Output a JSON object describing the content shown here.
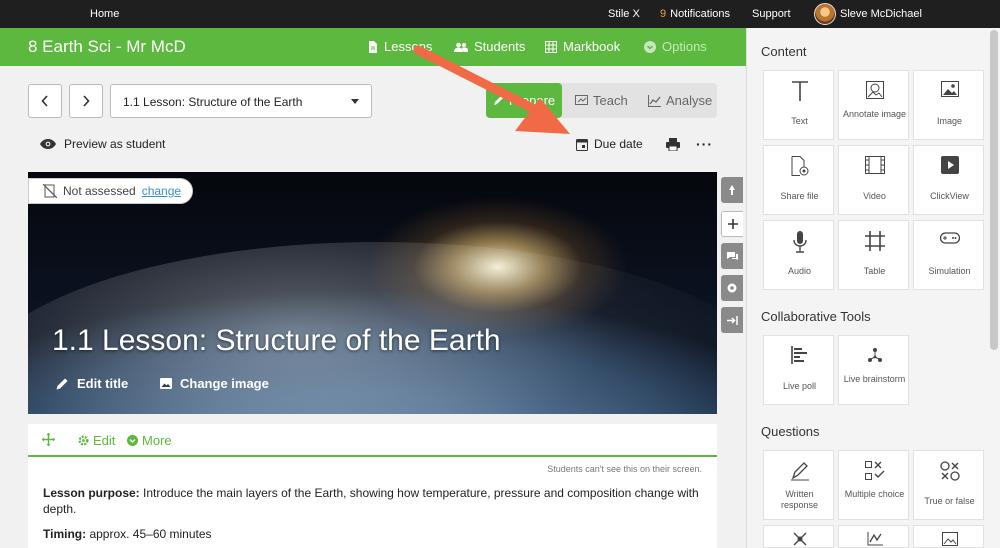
{
  "topbar": {
    "home": "Home",
    "stile": "Stile X",
    "notif_count": "9",
    "notif_label": "Notifications",
    "support": "Support",
    "user": "Sleve McDichael"
  },
  "header": {
    "class_title": "8 Earth Sci - Mr McD",
    "nav": {
      "lessons": "Lessons",
      "students": "Students",
      "markbook": "Markbook",
      "options": "Options"
    }
  },
  "lesson_select": {
    "value": "1.1 Lesson: Structure of the Earth"
  },
  "modes": {
    "prepare": "Prepare",
    "teach": "Teach",
    "analyse": "Analyse"
  },
  "actions": {
    "preview": "Preview as student",
    "due": "Due date",
    "more": "···"
  },
  "badge": {
    "status": "Not assessed",
    "change": "change"
  },
  "hero": {
    "title": "1.1 Lesson: Structure of the Earth",
    "edit_title": "Edit title",
    "change_image": "Change image"
  },
  "card": {
    "edit": "Edit",
    "more": "More",
    "note": "Students can't see this on their screen.",
    "purpose_label": "Lesson purpose:",
    "purpose_text": " Introduce the main layers of the Earth, showing how temperature, pressure and composition change with depth.",
    "timing_label": "Timing:",
    "timing_text": " approx. 45–60 minutes"
  },
  "panel": {
    "content_heading": "Content",
    "content": [
      "Text",
      "Annotate image",
      "Image",
      "Share file",
      "Video",
      "ClickView",
      "Audio",
      "Table",
      "Simulation"
    ],
    "collab_heading": "Collaborative Tools",
    "collab": [
      "Live poll",
      "Live brainstorm"
    ],
    "questions_heading": "Questions",
    "questions": [
      "Written response",
      "Multiple choice",
      "True or false"
    ]
  },
  "colors": {
    "brand_green": "#5cb83e",
    "arrow": "#ef6a45",
    "topbar": "#1f1f1f"
  }
}
